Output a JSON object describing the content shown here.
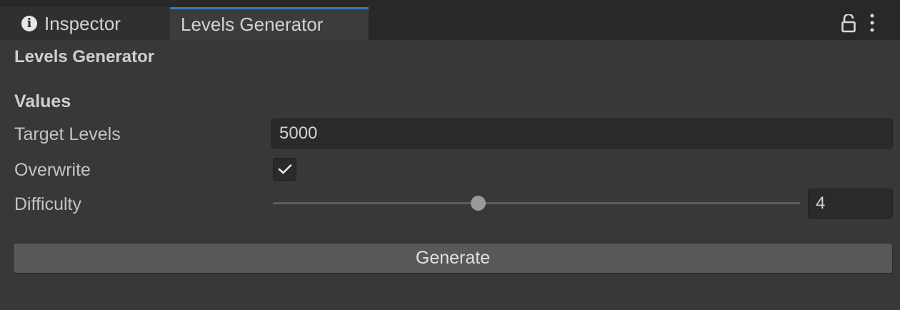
{
  "tabs": {
    "inspector_label": "Inspector",
    "active_label": "Levels Generator"
  },
  "header": {
    "title": "Levels Generator"
  },
  "section": {
    "title": "Values"
  },
  "fields": {
    "target_levels": {
      "label": "Target Levels",
      "value": "5000"
    },
    "overwrite": {
      "label": "Overwrite",
      "checked": true
    },
    "difficulty": {
      "label": "Difficulty",
      "value": "4",
      "fraction": 0.39
    }
  },
  "actions": {
    "generate_label": "Generate"
  },
  "colors": {
    "accent": "#3a79bb",
    "background": "#383838",
    "tabbar": "#282828"
  },
  "icons": {
    "info": "info-circle-icon",
    "lock": "lock-icon",
    "menu": "kebab-menu-icon",
    "check": "checkmark-icon"
  }
}
